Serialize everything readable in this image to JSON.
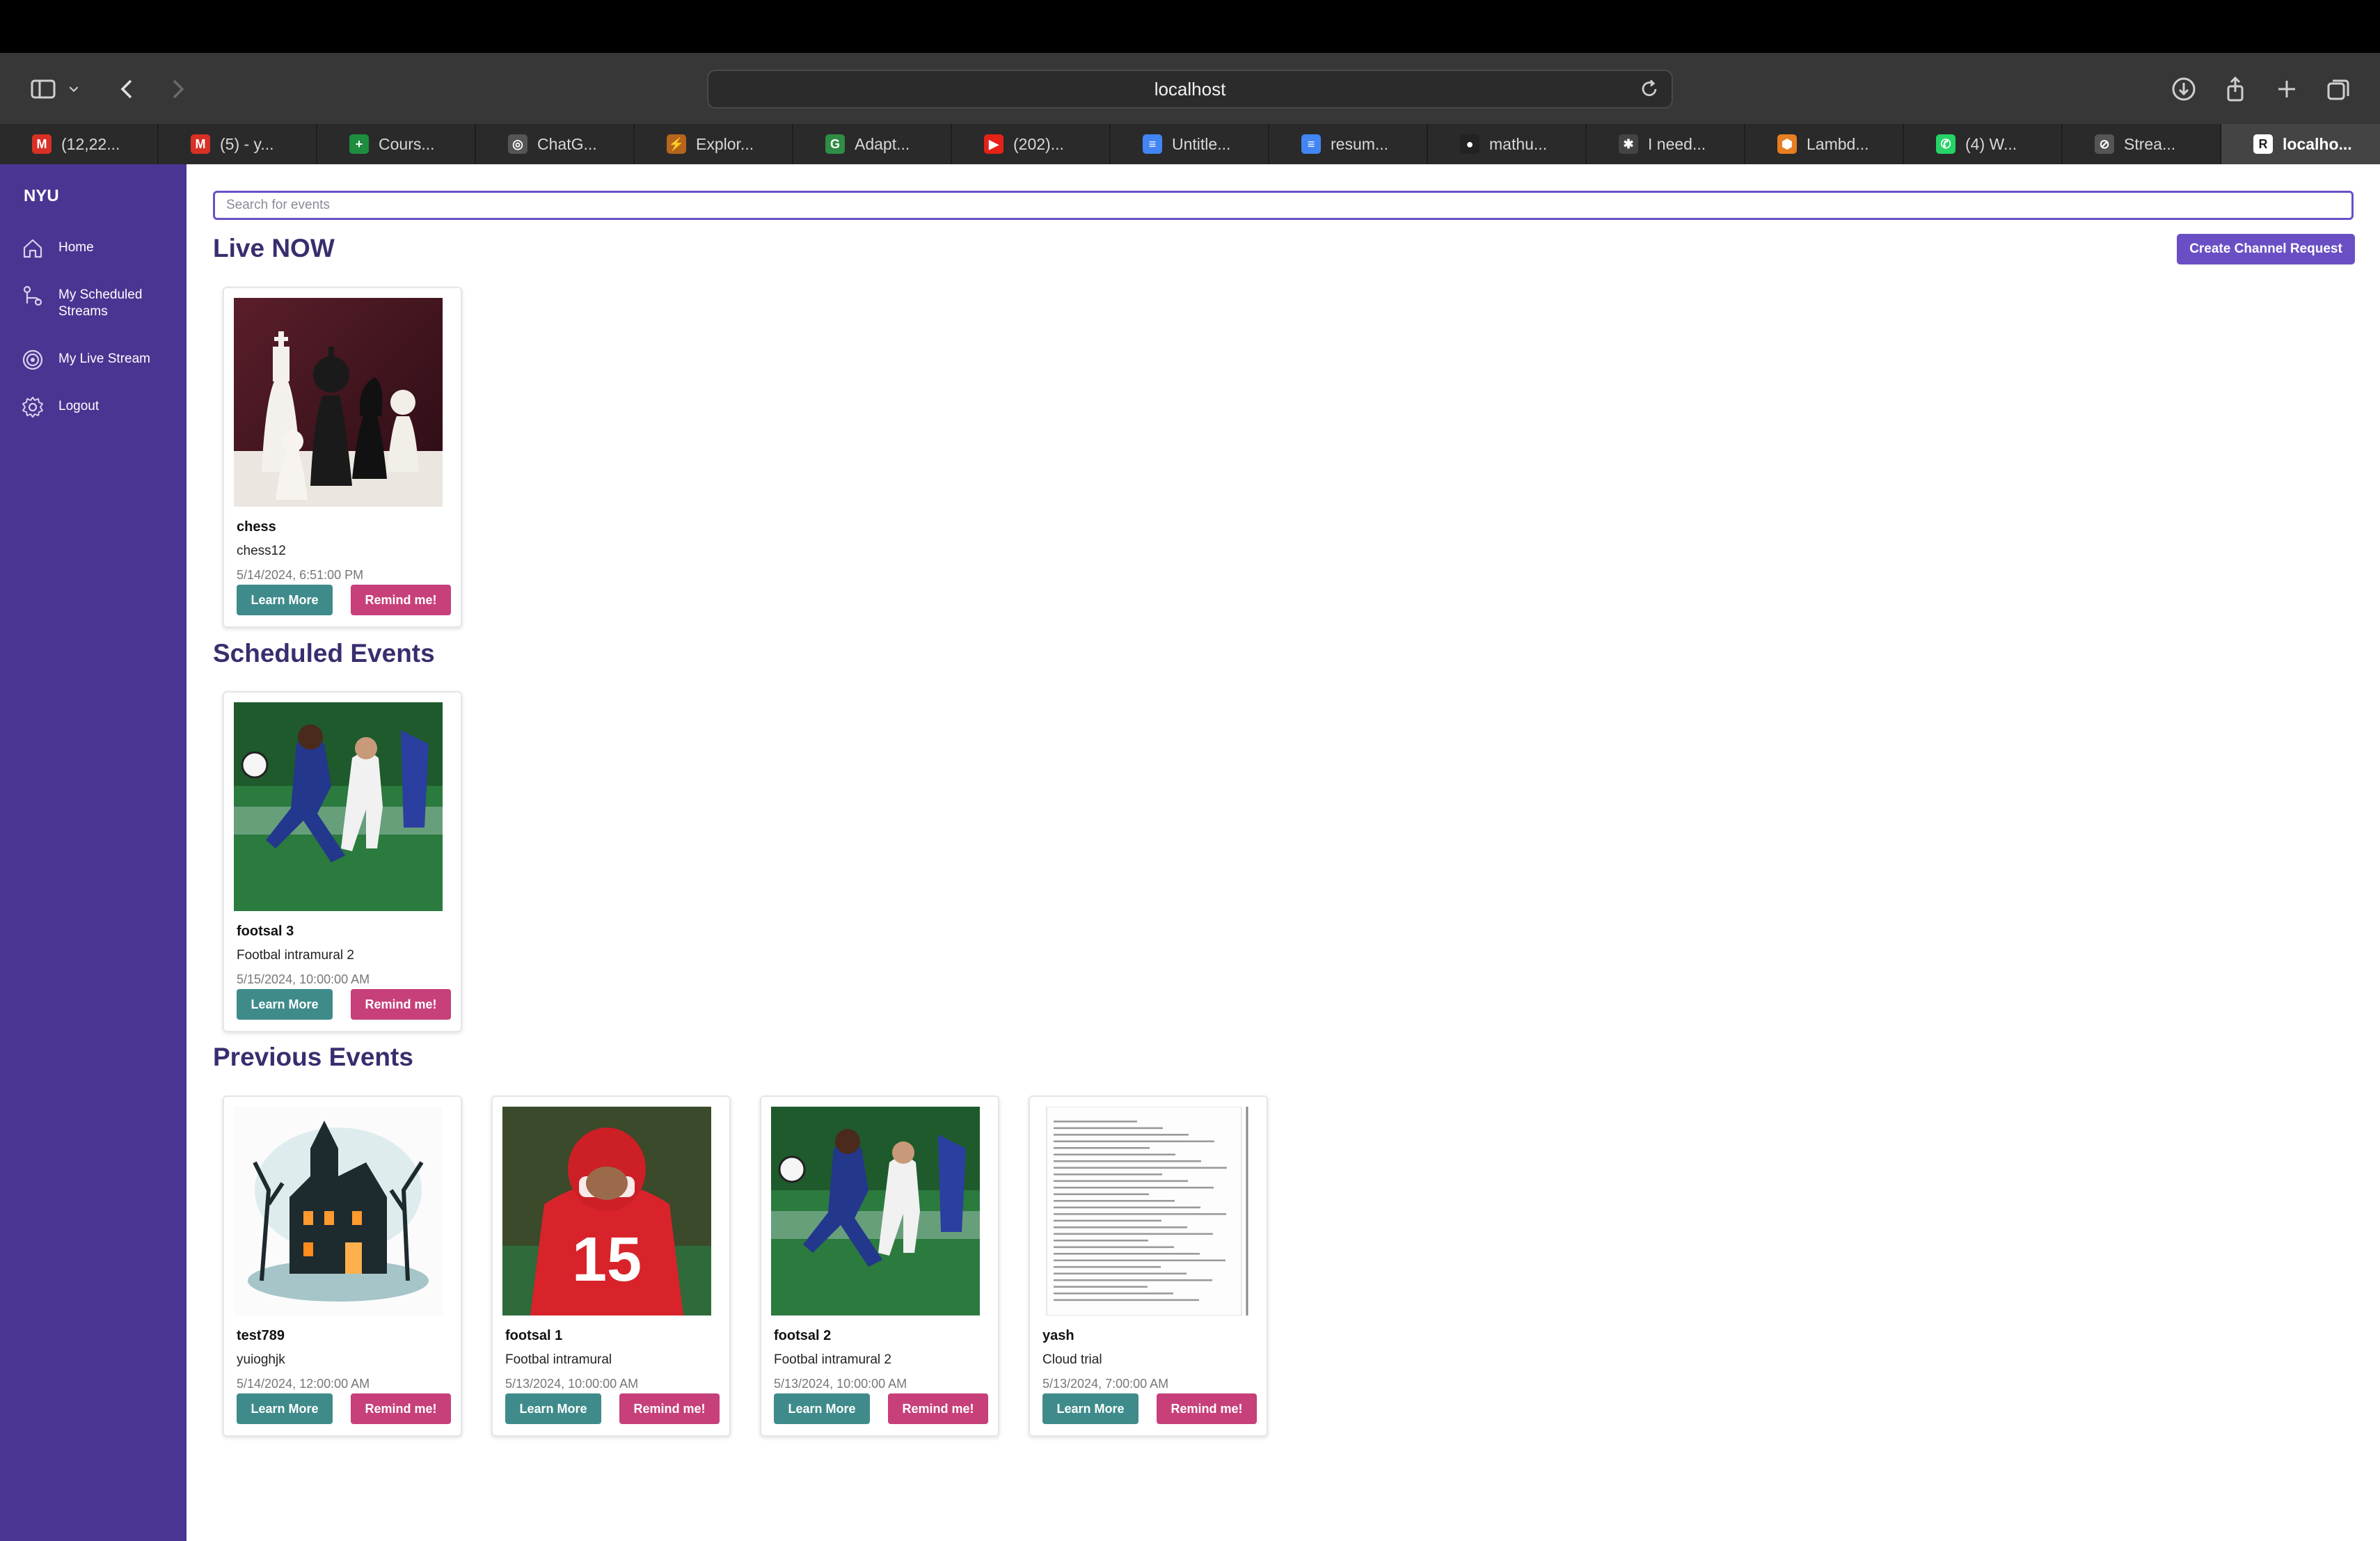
{
  "browser": {
    "url": "localhost",
    "tabs": [
      {
        "label": "(12,22...",
        "icon": "gmail-icon",
        "color": "#d93025",
        "glyph": "M"
      },
      {
        "label": "(5) - y...",
        "icon": "gmail-icon",
        "color": "#d93025",
        "glyph": "M"
      },
      {
        "label": "Cours...",
        "icon": "sheets-icon",
        "color": "#1e8e3e",
        "glyph": "+"
      },
      {
        "label": "ChatG...",
        "icon": "chatgpt-icon",
        "color": "#555555",
        "glyph": "◎"
      },
      {
        "label": "Explor...",
        "icon": "explore-icon",
        "color": "#b5651d",
        "glyph": "⚡"
      },
      {
        "label": "Adapt...",
        "icon": "geeks-icon",
        "color": "#2f8d46",
        "glyph": "G"
      },
      {
        "label": "(202)...",
        "icon": "youtube-icon",
        "color": "#e62117",
        "glyph": "▶"
      },
      {
        "label": "Untitle...",
        "icon": "docs-icon",
        "color": "#4285f4",
        "glyph": "≡"
      },
      {
        "label": "resum...",
        "icon": "docs-icon",
        "color": "#4285f4",
        "glyph": "≡"
      },
      {
        "label": "mathu...",
        "icon": "github-icon",
        "color": "#222222",
        "glyph": "●"
      },
      {
        "label": "I need...",
        "icon": "perplexity-icon",
        "color": "#444444",
        "glyph": "✱"
      },
      {
        "label": "Lambd...",
        "icon": "aws-icon",
        "color": "#e67e22",
        "glyph": "⬢"
      },
      {
        "label": "(4) W...",
        "icon": "whatsapp-icon",
        "color": "#25d366",
        "glyph": "✆"
      },
      {
        "label": "Strea...",
        "icon": "compass-icon",
        "color": "#555555",
        "glyph": "⊘"
      },
      {
        "label": "localho...",
        "icon": "react-icon",
        "color": "#ffffff",
        "glyph": "R",
        "active": true
      }
    ]
  },
  "sidebar": {
    "brand": "NYU",
    "items": [
      {
        "label": "Home",
        "icon": "home-icon"
      },
      {
        "label": "My Scheduled Streams",
        "icon": "schedule-icon"
      },
      {
        "label": "My Live Stream",
        "icon": "live-icon"
      },
      {
        "label": "Logout",
        "icon": "gear-icon"
      }
    ]
  },
  "search": {
    "placeholder": "Search for events"
  },
  "actions": {
    "create_channel": "Create Channel Request"
  },
  "sections": {
    "live": "Live NOW",
    "scheduled": "Scheduled Events",
    "previous": "Previous Events"
  },
  "buttons": {
    "learn_more": "Learn More",
    "remind": "Remind me!"
  },
  "live_events": [
    {
      "title": "chess",
      "subtitle": "chess12",
      "date": "5/14/2024, 6:51:00 PM",
      "image": "chess-image"
    }
  ],
  "scheduled_events": [
    {
      "title": "footsal 3",
      "subtitle": "Footbal intramural 2",
      "date": "5/15/2024, 10:00:00 AM",
      "image": "soccer-image"
    }
  ],
  "previous_events": [
    {
      "title": "test789",
      "subtitle": "yuioghjk",
      "date": "5/14/2024, 12:00:00 AM",
      "image": "haunted-house-image"
    },
    {
      "title": "footsal 1",
      "subtitle": "Footbal intramural",
      "date": "5/13/2024, 10:00:00 AM",
      "image": "football-player-image"
    },
    {
      "title": "footsal 2",
      "subtitle": "Footbal intramural 2",
      "date": "5/13/2024, 10:00:00 AM",
      "image": "soccer-image"
    },
    {
      "title": "yash",
      "subtitle": "Cloud trial",
      "date": "5/13/2024, 7:00:00 AM",
      "image": "document-image"
    }
  ]
}
